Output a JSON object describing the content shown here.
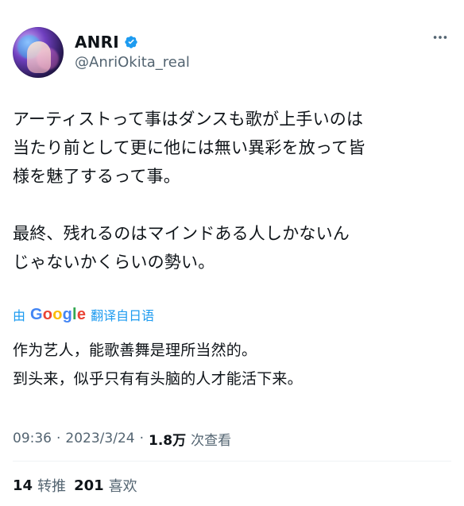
{
  "tweet": {
    "author": {
      "display_name": "ANRI",
      "handle": "@AnriOkita_real",
      "verified": true
    },
    "more_icon": "more-horizontal-icon",
    "text": "アーティストって事はダンスも歌が上手いのは\n当たり前として更に他には無い異彩を放って皆\n様を魅了するって事。\n\n最終、残れるのはマインドある人しかないん\nじゃないかくらいの勢い。",
    "translation": {
      "prefix": "由",
      "provider": "Google",
      "suffix": "翻译自日语",
      "text": "作为艺人，能歌善舞是理所当然的。\n到头来，似乎只有有头脑的人才能活下来。"
    },
    "meta": {
      "time": "09:36",
      "sep1": "·",
      "date": "2023/3/24",
      "sep2": "·",
      "views": "1.8万",
      "views_label": "次查看"
    },
    "stats": {
      "retweets": "14",
      "retweets_label": "转推",
      "likes": "201",
      "likes_label": "喜欢"
    }
  },
  "colors": {
    "accent": "#1d9bf0",
    "secondary_text": "#536471",
    "primary_text": "#0f1419",
    "divider": "#eff3f4"
  }
}
